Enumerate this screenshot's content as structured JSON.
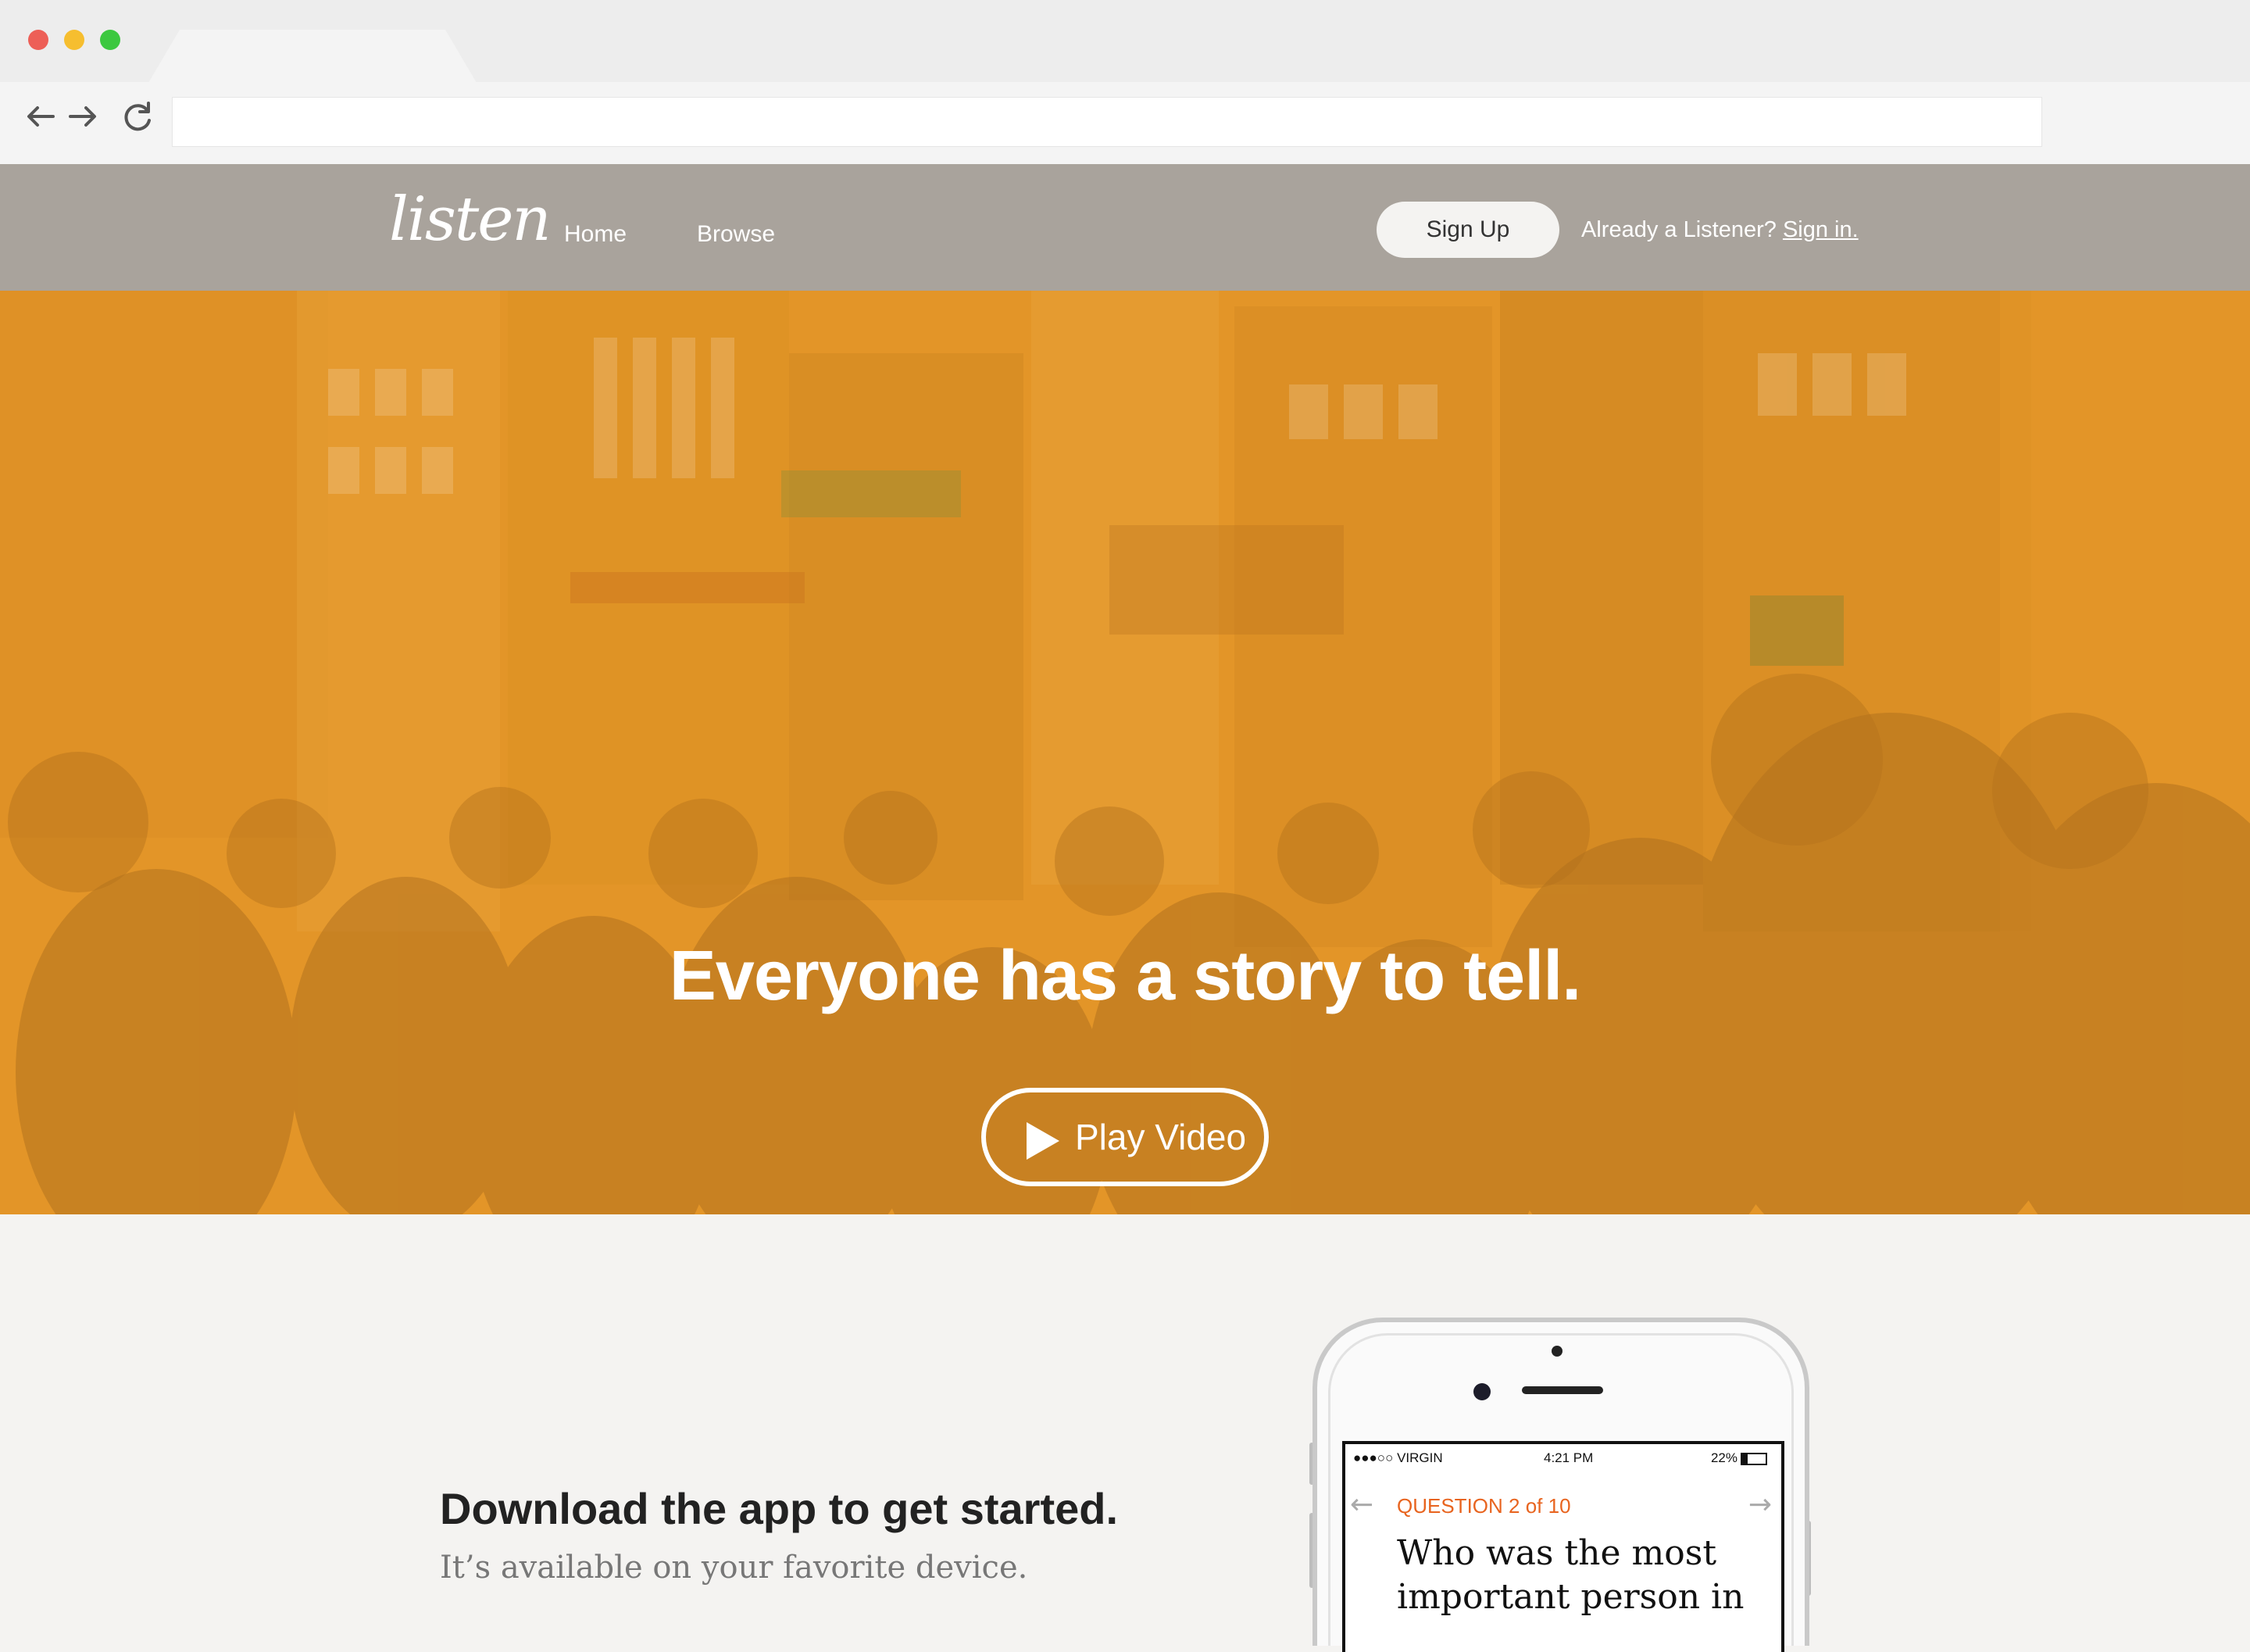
{
  "browser": {
    "url": "",
    "colors": {
      "close": "#ed5f57",
      "minimize": "#f6be2f",
      "maximize": "#3cc83f"
    },
    "icons": [
      "back-arrow-icon",
      "forward-arrow-icon",
      "reload-icon"
    ]
  },
  "header": {
    "logo": "listen",
    "nav": [
      {
        "label": "Home"
      },
      {
        "label": "Browse"
      }
    ],
    "signup_label": "Sign Up",
    "signin_prefix": "Already a Listener?",
    "signin_link": "Sign in."
  },
  "hero": {
    "title": "Everyone has a story to tell.",
    "play_label": "Play Video",
    "overlay_color": "#e39528"
  },
  "download": {
    "title": "Download the app to get started.",
    "subtitle": "It’s available on your favorite device."
  },
  "phone": {
    "carrier": "●●●○○ VIRGIN",
    "time": "4:21 PM",
    "battery": "22%",
    "question_label": "QUESTION 2 of 10",
    "question_text": "Who was the most important person in",
    "accent_color": "#e8641f"
  }
}
